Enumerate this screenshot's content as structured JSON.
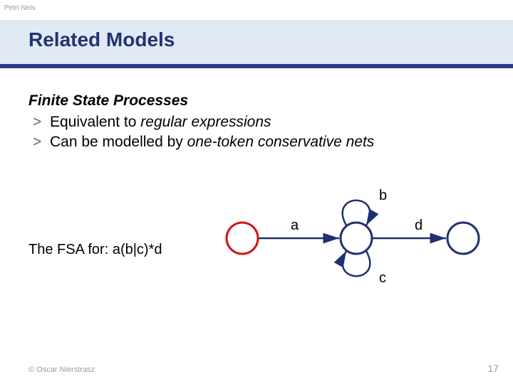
{
  "topic": "Petri Nets",
  "title": "Related Models",
  "subheading": "Finite State Processes",
  "bullets": [
    {
      "prefix": "Equivalent to ",
      "emph": "regular expressions",
      "suffix": ""
    },
    {
      "prefix": "Can be modelled by ",
      "emph": "one-token conservative nets",
      "suffix": ""
    }
  ],
  "bullet_marker": ">",
  "fsa_caption": "The FSA for: a(b|c)*d",
  "diagram_labels": {
    "a": "a",
    "b": "b",
    "c": "c",
    "d": "d"
  },
  "footer": {
    "copyright": "© Oscar Nierstrasz",
    "page": "17"
  }
}
